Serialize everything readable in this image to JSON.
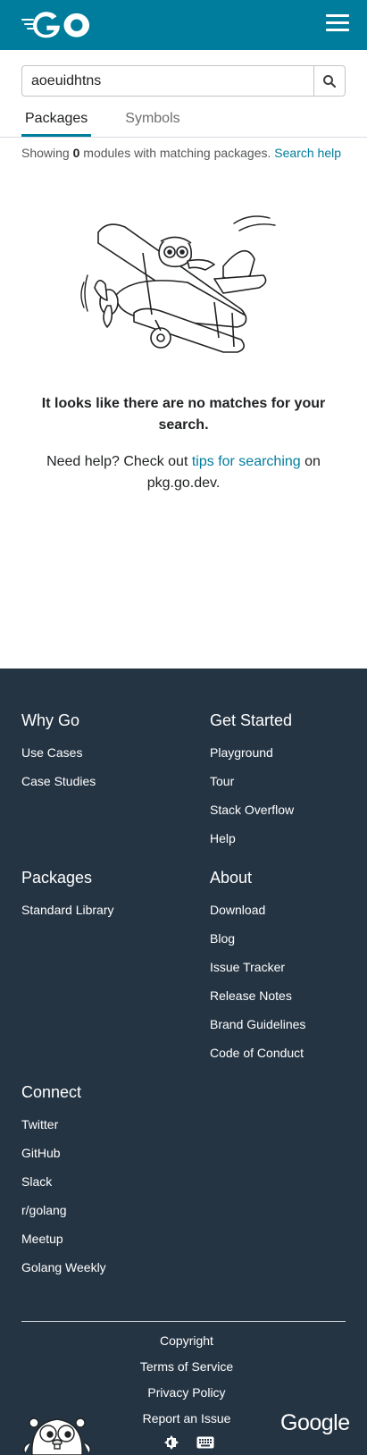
{
  "header": {
    "logo_alt": "GO",
    "menu_icon": "hamburger-icon"
  },
  "search": {
    "value": "aoeuidhtns",
    "button_icon": "search-icon"
  },
  "tabs": [
    {
      "label": "Packages",
      "active": true
    },
    {
      "label": "Symbols",
      "active": false
    }
  ],
  "results": {
    "showing_prefix": "Showing",
    "count": "0",
    "showing_suffix": "modules with matching packages.",
    "search_help": "Search help"
  },
  "empty_state": {
    "heading": "It looks like there are no matches for your search.",
    "help_prefix": "Need help? Check out",
    "help_link": "tips for searching",
    "help_suffix": "on pkg.go.dev."
  },
  "footer": {
    "why_go": {
      "title": "Why Go",
      "links": [
        "Use Cases",
        "Case Studies"
      ]
    },
    "get_started": {
      "title": "Get Started",
      "links": [
        "Playground",
        "Tour",
        "Stack Overflow",
        "Help"
      ]
    },
    "packages": {
      "title": "Packages",
      "links": [
        "Standard Library"
      ]
    },
    "about": {
      "title": "About",
      "links": [
        "Download",
        "Blog",
        "Issue Tracker",
        "Release Notes",
        "Brand Guidelines",
        "Code of Conduct"
      ]
    },
    "connect": {
      "title": "Connect",
      "links": [
        "Twitter",
        "GitHub",
        "Slack",
        "r/golang",
        "Meetup",
        "Golang Weekly"
      ]
    },
    "bottom_links": [
      "Copyright",
      "Terms of Service",
      "Privacy Policy",
      "Report an Issue"
    ],
    "google": "Google",
    "theme_icon": "theme-toggle-icon",
    "keyboard_icon": "keyboard-icon"
  },
  "colors": {
    "brand": "#007d9c",
    "footer_bg": "#253443",
    "link": "#007d9c"
  }
}
